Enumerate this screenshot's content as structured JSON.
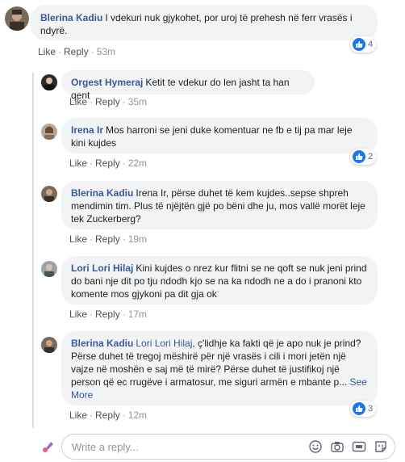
{
  "comments": [
    {
      "author": "Blerina Kadiu",
      "mention": "",
      "text": "I vdekuri nuk gjykohet, por uroj të prehesh në ferr vrasës i ndyrë.",
      "see_more": "",
      "like": "Like",
      "reply": "Reply",
      "time": "53m",
      "reactions": "4"
    },
    {
      "author": "Orgest Hymeraj",
      "mention": "",
      "text": "Ketit te vdekur do len jasht ta han qent",
      "see_more": "",
      "like": "Like",
      "reply": "Reply",
      "time": "35m",
      "reactions": ""
    },
    {
      "author": "Irena Ir",
      "mention": "",
      "text": "Mos harroni se jeni duke komentuar ne fb e tij pa mar leje kini kujdes",
      "see_more": "",
      "like": "Like",
      "reply": "Reply",
      "time": "22m",
      "reactions": "2"
    },
    {
      "author": "Blerina Kadiu",
      "mention": "",
      "text": "Irena Ir, përse duhet të kem kujdes..sepse shpreh mendimin tim. Plus të njëjtën gjë po bëni dhe ju, mos vallë morët leje tek Zuckerberg?",
      "see_more": "",
      "like": "Like",
      "reply": "Reply",
      "time": "19m",
      "reactions": ""
    },
    {
      "author": "Lori Lori Hilaj",
      "mention": "",
      "text": "Kini kujdes o nrez kur flitni se ne qoft se nuk jeni prind do bani nje dit po tju ndodh kjo se na ka ndodh ne a do i pranoni kto komente mos gjykoni pa dit gja ok",
      "see_more": "",
      "like": "Like",
      "reply": "Reply",
      "time": "17m",
      "reactions": ""
    },
    {
      "author": "Blerina Kadiu",
      "mention": "Lori Lori Hilaj",
      "text": ", ç'lidhje ka fakti që je apo nuk je prind? Përse duhet të tregoj mëshirë për një vrasës i cili i mori jetën një vajze në moshën e saj më të mirë? Përse duhet të justifikoj një person që ec rrugëve i armatosur, me siguri armën e mbante p...",
      "see_more": "See More",
      "like": "Like",
      "reply": "Reply",
      "time": "12m",
      "reactions": "3"
    }
  ],
  "reply_box": {
    "placeholder": "Write a reply...",
    "icons": [
      "emoji-icon",
      "camera-icon",
      "gif-icon",
      "sticker-icon"
    ]
  },
  "colors": {
    "link": "#385898",
    "bubble": "#f2f3f5",
    "like_blue": "#1877f2"
  }
}
